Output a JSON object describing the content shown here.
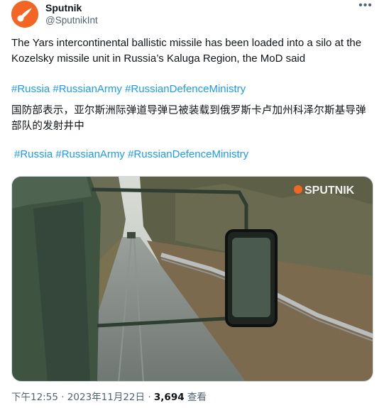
{
  "author": {
    "name": "Sputnik",
    "handle": "@SputnikInt",
    "avatar_color": "#f26522"
  },
  "menu_icon": "more-horizontal-icon",
  "post": {
    "text_en": "The Yars intercontinental ballistic missile has been loaded into a silo at the Kozelsky missile unit in Russia’s Kaluga Region, the MoD said",
    "hashtags_1": [
      "#Russia",
      "#RussianArmy",
      "#RussianDefenceMinistry"
    ],
    "text_zh": "国防部表示，亚尔斯洲际弹道导弹已被装载到俄罗斯卡卢加州科泽尔斯基导弹部队的发射井中",
    "hashtags_2": [
      "#Russia",
      "#RussianArmy",
      "#RussianDefenceMinistry"
    ]
  },
  "media": {
    "watermark": "SPUTNIK",
    "description_icon": "video-thumbnail"
  },
  "footer": {
    "time": "下午12:55",
    "separator": "·",
    "date": "2023年11月22日",
    "views_count": "3,694",
    "views_label": "查看"
  },
  "colors": {
    "link": "#1d9bf0",
    "secondary": "#536471",
    "text": "#0f1419"
  }
}
